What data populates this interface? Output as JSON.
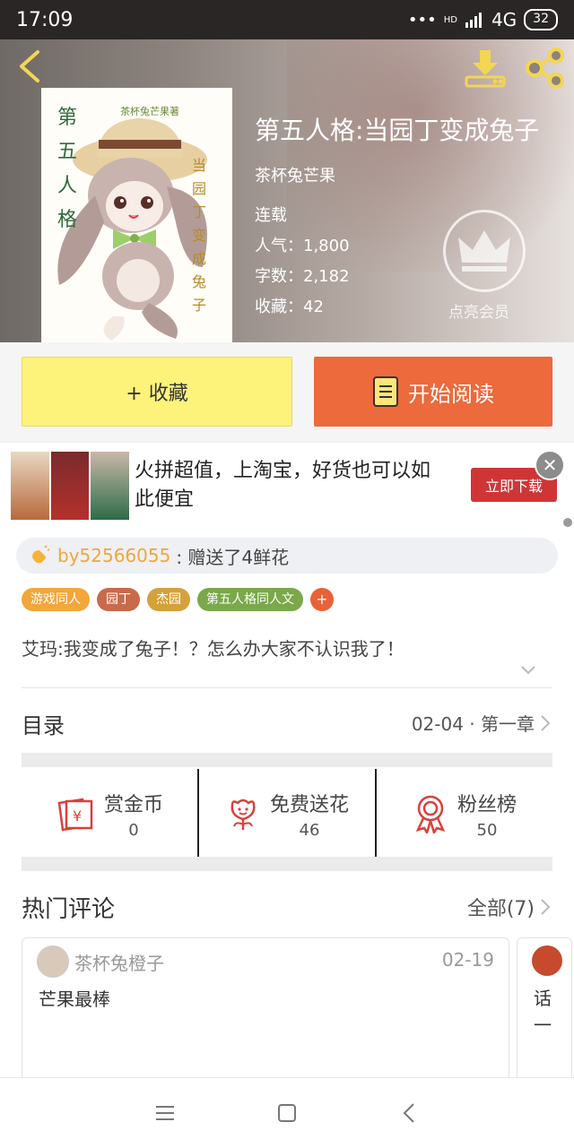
{
  "status_bar": {
    "time": "17:09",
    "dots": "•••",
    "network": "4G",
    "hd": "HD",
    "battery": "32"
  },
  "book": {
    "title": "第五人格:当园丁变成兔子",
    "author": "茶杯兔芒果",
    "status": "连载",
    "popularity": "人气：1,800",
    "word_count": "字数：2,182",
    "favorites": "收藏：42",
    "cover_text_left": "第五人格",
    "cover_text_right": "当园丁变成兔子",
    "cover_text_top": "茶杯兔芒果著"
  },
  "vip": {
    "label": "点亮会员"
  },
  "actions": {
    "favorite_label": "+ 收藏",
    "read_label": "开始阅读"
  },
  "ad": {
    "text": "火拼超值，上淘宝，好货也可以如此便宜",
    "button": "立即下载",
    "close": "✕"
  },
  "flower_gift": {
    "user": "by52566055",
    "message": ": 赠送了4鲜花"
  },
  "tags": [
    {
      "label": "游戏同人",
      "color": "#f2a73a"
    },
    {
      "label": "园丁",
      "color": "#c96a4b"
    },
    {
      "label": "杰园",
      "color": "#d5a13a"
    },
    {
      "label": "第五人格同人文",
      "color": "#7aa84a"
    }
  ],
  "tag_more": "+",
  "summary": "艾玛:我变成了兔子！？怎么办大家不认识我了！",
  "toc": {
    "title": "目录",
    "latest": "02-04 · 第一章"
  },
  "stats": [
    {
      "label": "赏金币",
      "value": "0",
      "icon": "red-envelope-icon"
    },
    {
      "label": "免费送花",
      "value": "46",
      "icon": "flower-icon"
    },
    {
      "label": "粉丝榜",
      "value": "50",
      "icon": "medal-icon"
    }
  ],
  "hot_comments": {
    "title": "热门评论",
    "all_label": "全部(7)",
    "items": [
      {
        "user": "茶杯兔橙子",
        "date": "02-19",
        "text": "芒果最棒"
      },
      {
        "text": "话\n一"
      }
    ]
  },
  "colors": {
    "accent_orange": "#ec6a3b",
    "fav_yellow": "#fdf27a",
    "flower_user": "#f0a63c",
    "icon_red": "#d9413a"
  }
}
